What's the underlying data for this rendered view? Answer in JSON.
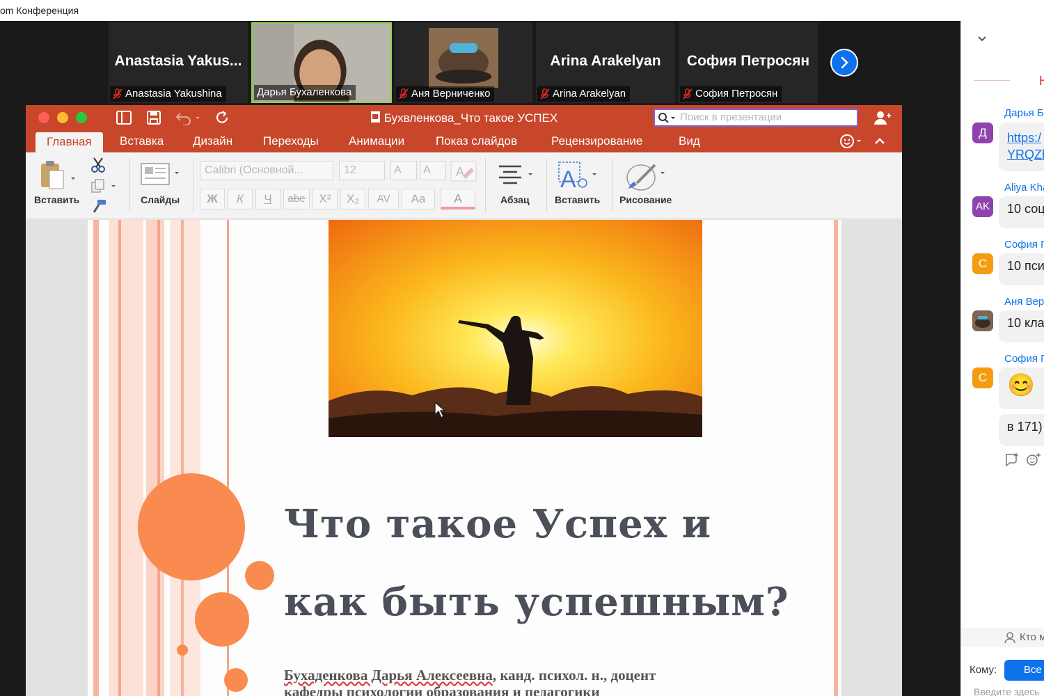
{
  "window": {
    "title": "om Конференция"
  },
  "participants": [
    {
      "big_name": "Anastasia  Yakus...",
      "label": "Anastasia Yakushina",
      "muted": true,
      "video": false
    },
    {
      "big_name": "",
      "label": "Дарья Бухаленкова",
      "muted": false,
      "video": true
    },
    {
      "big_name": "",
      "label": "Аня Верниченко",
      "muted": true,
      "video": false
    },
    {
      "big_name": "Arina Arakelyan",
      "label": "Arina Arakelyan",
      "muted": true,
      "video": false
    },
    {
      "big_name": "София Петросян",
      "label": "София Петросян",
      "muted": true,
      "video": false
    }
  ],
  "ppt": {
    "doc_title": "Бухвленкова_Что такое УСПЕХ",
    "search_placeholder": "Поиск в презентации",
    "tabs": [
      "Главная",
      "Вставка",
      "Дизайн",
      "Переходы",
      "Анимации",
      "Показ слайдов",
      "Рецензирование",
      "Вид"
    ],
    "active_tab": "Главная",
    "ribbon": {
      "paste_label": "Вставить",
      "slides_label": "Слайды",
      "font_name": "Calibri (Основной...",
      "font_size": "12",
      "bold": "Ж",
      "italic": "К",
      "underline": "Ч",
      "strike": "abe",
      "superscript": "X²",
      "subscript": "X₂",
      "spacing": "AV",
      "case": "Aa",
      "font_color": "A",
      "grow": "A",
      "shrink": "A",
      "paragraph_label": "Абзац",
      "insert_label": "Вставить",
      "drawing_label": "Рисование"
    },
    "slide": {
      "title_line1": "Что такое Успех и",
      "title_line2": "как быть успешным?",
      "author_name": "Бухаденкова Дарья Алексеевна",
      "author_rest": ", канд. психол. н.,  доцент",
      "author_line2": "кафедры психологии образования и педагогики"
    }
  },
  "chat": {
    "header_letter": "Н",
    "messages": [
      {
        "sender": "Дарья Б",
        "avatar": "Д",
        "avatar_color": "#8e44ad",
        "text_line1": "https:/",
        "text_line2": "YRQZb"
      },
      {
        "sender": "Aliya Kha",
        "avatar": "AK",
        "avatar_color": "#8e44ad",
        "text": "10 соц"
      },
      {
        "sender": "София П",
        "avatar": "С",
        "avatar_color": "#f39c12",
        "text": "10 пси"
      },
      {
        "sender": "Аня Вер",
        "avatar": "",
        "avatar_color": "#6b5a48",
        "text": "10 кла"
      },
      {
        "sender": "София П",
        "avatar": "С",
        "avatar_color": "#f39c12",
        "text": "😊"
      }
    ],
    "extra_message": "в 171)",
    "who_label": "Кто м",
    "to_label": "Кому:",
    "to_value": "Все",
    "input_placeholder": "Введите здесь"
  }
}
